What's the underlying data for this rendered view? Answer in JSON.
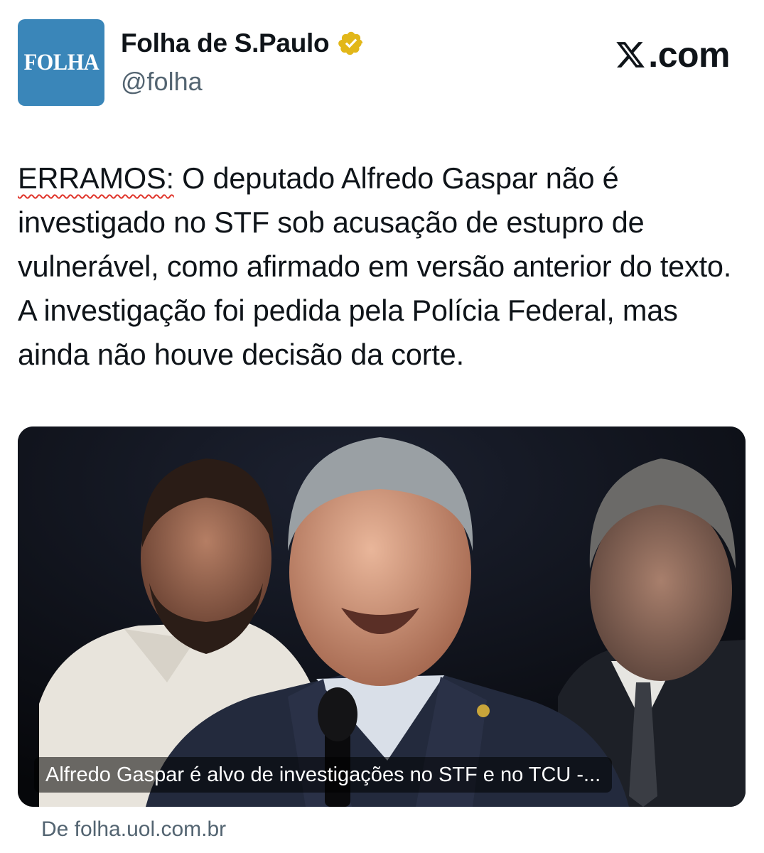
{
  "account": {
    "avatar_text": "FOLHA",
    "display_name": "Folha de S.Paulo",
    "handle": "@folha",
    "verified_icon": "gold-verified-badge-icon",
    "avatar_color": "#3a86b9"
  },
  "platform": {
    "logo_icon": "x-logo-icon",
    "domain_suffix": ".com"
  },
  "post": {
    "lead_word": "ERRAMOS",
    "lead_colon": ":",
    "body": " O deputado Alfredo Gaspar não é investigado no STF sob acusação de estupro de vulnerável, como afirmado em versão anterior do texto. A investigação foi pedida pela Polícia Federal, mas ainda não houve decisão da corte."
  },
  "link_card": {
    "title": "Alfredo Gaspar é alvo de investigações no STF e no TCU -...",
    "source": "De folha.uol.com.br",
    "image_description_icon": "news-photo"
  },
  "colors": {
    "text": "#0f1419",
    "secondary": "#536471",
    "verified_gold": "#e2b719",
    "spellcheck_red": "#e0352b"
  }
}
